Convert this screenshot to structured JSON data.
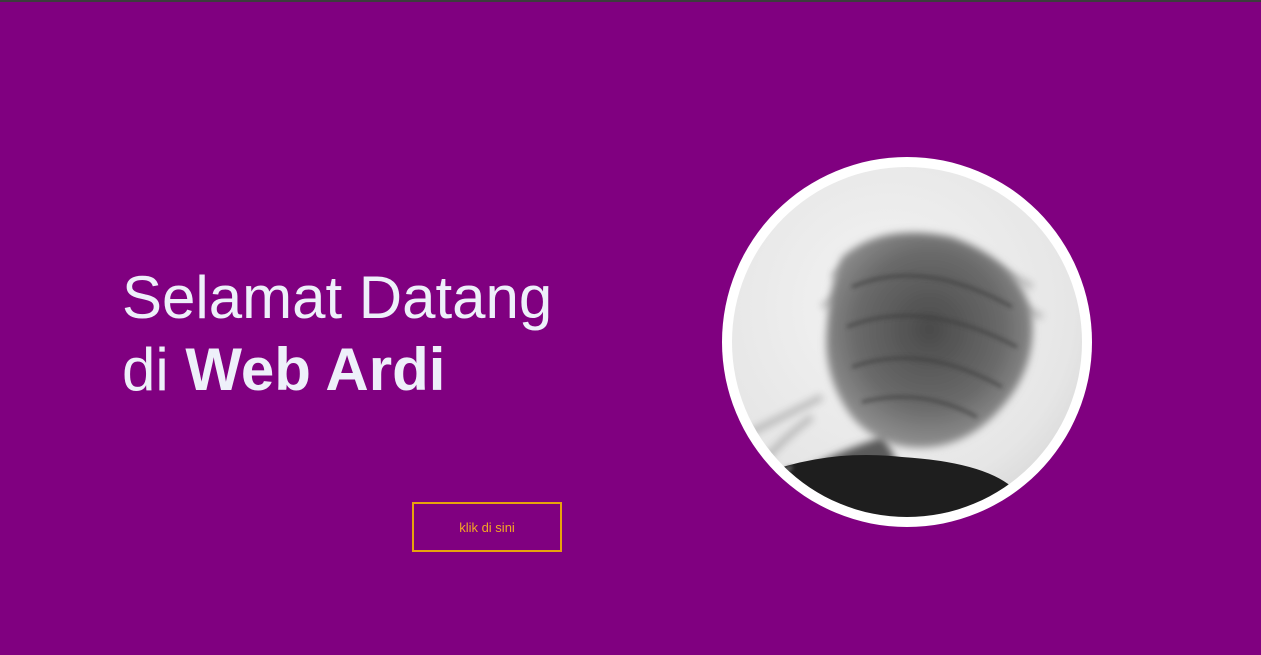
{
  "hero": {
    "line1": "Selamat Datang",
    "line2_prefix": "di",
    "line2_bold": "Web Ardi"
  },
  "cta": {
    "label": "klik di sini"
  },
  "profile": {
    "image": "blurred-hair-photo"
  },
  "colors": {
    "background": "#800080",
    "text": "#eef0fa",
    "button_border": "#e8a20c",
    "button_text": "#f5a623",
    "frame": "#ffffff"
  }
}
